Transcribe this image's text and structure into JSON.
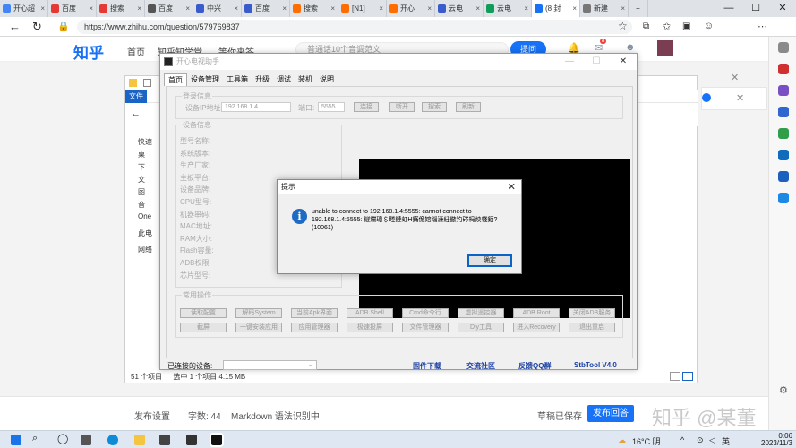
{
  "browser": {
    "tabs": [
      {
        "label": "开心超",
        "color": "#4285f4"
      },
      {
        "label": "百度",
        "color": "#e53935"
      },
      {
        "label": "搜索",
        "color": "#e53935"
      },
      {
        "label": "百度",
        "color": "#555555"
      },
      {
        "label": "中兴",
        "color": "#3a5bcc"
      },
      {
        "label": "百度",
        "color": "#3a5bcc"
      },
      {
        "label": "搜索",
        "color": "#ff6d00"
      },
      {
        "label": "[N1]",
        "color": "#ff6d00"
      },
      {
        "label": "开心",
        "color": "#ff6d00"
      },
      {
        "label": "云电",
        "color": "#3a5bcc"
      },
      {
        "label": "云电",
        "color": "#0f9d58"
      },
      {
        "label": "(8 封",
        "color": "#1772f6"
      },
      {
        "label": "新建",
        "color": "#777777"
      }
    ],
    "new_tab": "+",
    "url": "https://www.zhihu.com/question/579769837"
  },
  "zhihu": {
    "logo": "知乎",
    "nav": [
      "首页",
      "知乎知学堂",
      "等你来答"
    ],
    "search_placeholder": "普通话10个音调范文",
    "ask_label": "提问",
    "badge": "8"
  },
  "explorer": {
    "file_tab": "文件",
    "tree": [
      "快速",
      "桌",
      "下",
      "文",
      "图",
      "音",
      "One",
      "此电",
      "网络"
    ],
    "status_count": "51 个项目",
    "status_selected": "选中 1 个项目  4.15 MB"
  },
  "app": {
    "title": "开心电视助手",
    "menu": [
      "首页",
      "设备管理",
      "工具箱",
      "升级",
      "调试",
      "装机",
      "说明"
    ],
    "login": {
      "group": "登录信息",
      "ip_label": "设备IP地址:",
      "ip_value": "192.168.1.4",
      "port_label": "端口:",
      "port_value": "5555",
      "buttons": [
        "连接",
        "断开",
        "搜索",
        "刷新"
      ]
    },
    "device": {
      "group": "设备信息",
      "fields": [
        "型号名称:",
        "系统版本:",
        "生产厂家:",
        "主板平台:",
        "设备品牌:",
        "CPU型号:",
        "机器串码:",
        "MAC地址:",
        "RAM大小:",
        "Flash容量:",
        "ADB权限:",
        "芯片型号:"
      ]
    },
    "ops": {
      "group": "常用操作",
      "row1": [
        "读取配置",
        "解码System",
        "当前Apk界面",
        "ADB Shell",
        "Cmd命令行",
        "虚拟遥控器",
        "ADB Root",
        "关闭ADB服务"
      ],
      "row2": [
        "截屏",
        "一键安装应用",
        "应用管理器",
        "极速投屏",
        "文件管理器",
        "Diy工具",
        "进入Recovery",
        "退出重启"
      ]
    },
    "status": {
      "connected_label": "已连接的设备:",
      "links": [
        "固件下载",
        "交流社区",
        "反馈QQ群",
        "StbTool V4.0"
      ]
    }
  },
  "messagebox": {
    "title": "提示",
    "body": "unable to connect to 192.168.1.4:5555: cannot connect to 192.168.1.4:5555: 鐩爣璁＄畻鏈虹Н鏋佹嫆缁濓紝鏃犳硶杩炴帴銆? (10061)",
    "ok": "确定"
  },
  "editor_footer": {
    "settings": "发布设置",
    "word_count": "字数: 44",
    "hint": "Markdown 语法识别中",
    "draft": "草稿已保存",
    "publish": "发布回答",
    "watermark": "知乎 @某董"
  },
  "taskbar": {
    "weather": "16°C 阴",
    "lang": "英",
    "time": "0:06",
    "date": "2023/11/3"
  }
}
